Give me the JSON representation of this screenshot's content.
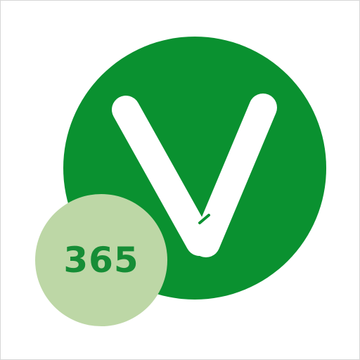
{
  "logo": {
    "icon": "v-checkmark-icon",
    "badge_text": "365",
    "colors": {
      "primary_green": "#0a9130",
      "badge_fill": "#bdd7a6",
      "badge_text": "#168d36",
      "mark": "#ffffff",
      "frame": "#d6d6d6"
    }
  }
}
